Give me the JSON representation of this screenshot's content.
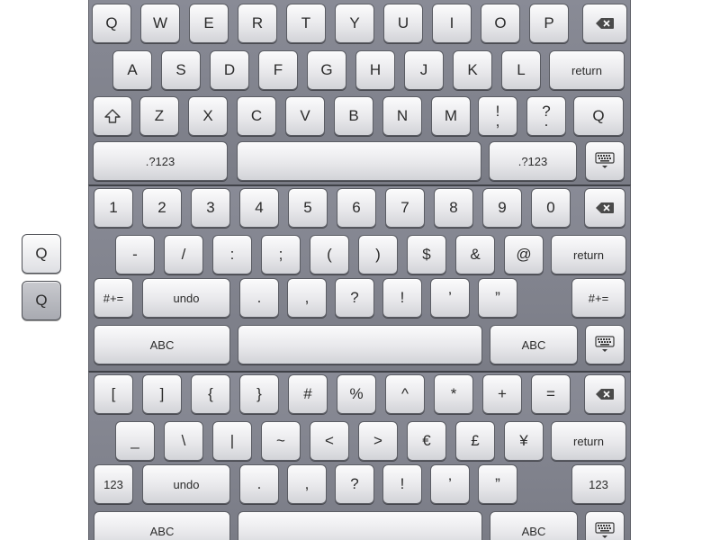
{
  "keyboards": [
    {
      "id": "letters",
      "keys": [
        {
          "label": "Q",
          "name": "key-q"
        },
        {
          "label": "W",
          "name": "key-w"
        },
        {
          "label": "E",
          "name": "key-e"
        },
        {
          "label": "R",
          "name": "key-r"
        },
        {
          "label": "T",
          "name": "key-t"
        },
        {
          "label": "Y",
          "name": "key-y"
        },
        {
          "label": "U",
          "name": "key-u"
        },
        {
          "label": "I",
          "name": "key-i"
        },
        {
          "label": "O",
          "name": "key-o"
        },
        {
          "label": "P",
          "name": "key-p"
        },
        {
          "icon": "backspace",
          "name": "backspace-key"
        },
        {
          "label": "A",
          "name": "key-a"
        },
        {
          "label": "S",
          "name": "key-s"
        },
        {
          "label": "D",
          "name": "key-d"
        },
        {
          "label": "F",
          "name": "key-f"
        },
        {
          "label": "G",
          "name": "key-g"
        },
        {
          "label": "H",
          "name": "key-h"
        },
        {
          "label": "J",
          "name": "key-j"
        },
        {
          "label": "K",
          "name": "key-k"
        },
        {
          "label": "L",
          "name": "key-l"
        },
        {
          "label": "return",
          "name": "return-key",
          "small": true
        },
        {
          "icon": "shift",
          "name": "shift-key"
        },
        {
          "label": "Z",
          "name": "key-z"
        },
        {
          "label": "X",
          "name": "key-x"
        },
        {
          "label": "C",
          "name": "key-c"
        },
        {
          "label": "V",
          "name": "key-v"
        },
        {
          "label": "B",
          "name": "key-b"
        },
        {
          "label": "N",
          "name": "key-n"
        },
        {
          "label": "M",
          "name": "key-m"
        },
        {
          "label": "!\n,",
          "name": "key-exclam-comma"
        },
        {
          "label": "?\n.",
          "name": "key-question-period"
        },
        {
          "label": "Q",
          "name": "key-q-alt"
        },
        {
          "label": ".?123",
          "name": "numbers-mode-key",
          "small": true
        },
        {
          "label": "",
          "name": "space-bar"
        },
        {
          "label": ".?123",
          "name": "numbers-mode-key-right",
          "small": true
        },
        {
          "icon": "keyboard",
          "name": "dismiss-keyboard-key"
        }
      ]
    },
    {
      "id": "numbers",
      "keys": [
        {
          "label": "1",
          "name": "key-1"
        },
        {
          "label": "2",
          "name": "key-2"
        },
        {
          "label": "3",
          "name": "key-3"
        },
        {
          "label": "4",
          "name": "key-4"
        },
        {
          "label": "5",
          "name": "key-5"
        },
        {
          "label": "6",
          "name": "key-6"
        },
        {
          "label": "7",
          "name": "key-7"
        },
        {
          "label": "8",
          "name": "key-8"
        },
        {
          "label": "9",
          "name": "key-9"
        },
        {
          "label": "0",
          "name": "key-0"
        },
        {
          "icon": "backspace",
          "name": "backspace-key"
        },
        {
          "label": "-",
          "name": "key-hyphen"
        },
        {
          "label": "/",
          "name": "key-slash"
        },
        {
          "label": ":",
          "name": "key-colon"
        },
        {
          "label": ";",
          "name": "key-semicolon"
        },
        {
          "label": "(",
          "name": "key-open-paren"
        },
        {
          "label": ")",
          "name": "key-close-paren"
        },
        {
          "label": "$",
          "name": "key-dollar"
        },
        {
          "label": "&",
          "name": "key-ampersand"
        },
        {
          "label": "@",
          "name": "key-at"
        },
        {
          "label": "return",
          "name": "return-key",
          "small": true
        },
        {
          "label": "#+=",
          "name": "symbols-mode-key",
          "small": true
        },
        {
          "label": "undo",
          "name": "undo-key",
          "small": true
        },
        {
          "label": ".",
          "name": "key-period"
        },
        {
          "label": ",",
          "name": "key-comma"
        },
        {
          "label": "?",
          "name": "key-question"
        },
        {
          "label": "!",
          "name": "key-exclam"
        },
        {
          "label": "’",
          "name": "key-apostrophe"
        },
        {
          "label": "”",
          "name": "key-quote"
        },
        {
          "label": "#+=",
          "name": "symbols-mode-key-right",
          "small": true
        },
        {
          "label": "ABC",
          "name": "letters-mode-key",
          "small": true
        },
        {
          "label": "",
          "name": "space-bar"
        },
        {
          "label": "ABC",
          "name": "letters-mode-key-right",
          "small": true
        },
        {
          "icon": "keyboard",
          "name": "dismiss-keyboard-key"
        }
      ]
    },
    {
      "id": "symbols",
      "keys": [
        {
          "label": "[",
          "name": "key-open-bracket"
        },
        {
          "label": "]",
          "name": "key-close-bracket"
        },
        {
          "label": "{",
          "name": "key-open-brace"
        },
        {
          "label": "}",
          "name": "key-close-brace"
        },
        {
          "label": "#",
          "name": "key-hash"
        },
        {
          "label": "%",
          "name": "key-percent"
        },
        {
          "label": "^",
          "name": "key-caret"
        },
        {
          "label": "*",
          "name": "key-asterisk"
        },
        {
          "label": "+",
          "name": "key-plus"
        },
        {
          "label": "=",
          "name": "key-equals"
        },
        {
          "icon": "backspace",
          "name": "backspace-key"
        },
        {
          "label": "_",
          "name": "key-underscore"
        },
        {
          "label": "\\",
          "name": "key-backslash"
        },
        {
          "label": "|",
          "name": "key-pipe"
        },
        {
          "label": "~",
          "name": "key-tilde"
        },
        {
          "label": "<",
          "name": "key-less-than"
        },
        {
          "label": ">",
          "name": "key-greater-than"
        },
        {
          "label": "€",
          "name": "key-euro"
        },
        {
          "label": "£",
          "name": "key-pound"
        },
        {
          "label": "¥",
          "name": "key-yen"
        },
        {
          "label": "return",
          "name": "return-key",
          "small": true
        },
        {
          "label": "123",
          "name": "numbers-mode-key",
          "small": true
        },
        {
          "label": "undo",
          "name": "undo-key",
          "small": true
        },
        {
          "label": ".",
          "name": "key-period"
        },
        {
          "label": ",",
          "name": "key-comma"
        },
        {
          "label": "?",
          "name": "key-question"
        },
        {
          "label": "!",
          "name": "key-exclam"
        },
        {
          "label": "’",
          "name": "key-apostrophe"
        },
        {
          "label": "”",
          "name": "key-quote"
        },
        {
          "label": "123",
          "name": "numbers-mode-key-right",
          "small": true
        },
        {
          "label": "ABC",
          "name": "letters-mode-key",
          "small": true
        },
        {
          "label": "",
          "name": "space-bar"
        },
        {
          "label": "ABC",
          "name": "letters-mode-key-right",
          "small": true
        },
        {
          "icon": "keyboard",
          "name": "dismiss-keyboard-key"
        }
      ]
    }
  ],
  "side_keys": [
    {
      "label": "Q",
      "state": "normal"
    },
    {
      "label": "Q",
      "state": "pressed"
    }
  ]
}
